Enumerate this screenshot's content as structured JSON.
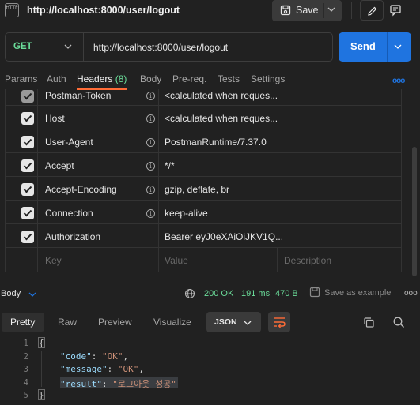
{
  "topbar": {
    "icon_text": "HTTP",
    "title": "http://localhost:8000/user/logout",
    "save_label": "Save"
  },
  "request": {
    "method": "GET",
    "url": "http://localhost:8000/user/logout",
    "send_label": "Send"
  },
  "tabs": {
    "params": "Params",
    "auth": "Auth",
    "headers": "Headers",
    "headers_count": "(8)",
    "body": "Body",
    "prereq": "Pre-req.",
    "tests": "Tests",
    "settings": "Settings",
    "more": "ooo"
  },
  "headers": [
    {
      "key": "Postman-Token",
      "value": "<calculated when reques...",
      "info": "i"
    },
    {
      "key": "Host",
      "value": "<calculated when reques...",
      "info": "i"
    },
    {
      "key": "User-Agent",
      "value": "PostmanRuntime/7.37.0",
      "info": "i"
    },
    {
      "key": "Accept",
      "value": "*/*",
      "info": "i"
    },
    {
      "key": "Accept-Encoding",
      "value": "gzip, deflate, br",
      "info": "i"
    },
    {
      "key": "Connection",
      "value": "keep-alive",
      "info": "i"
    },
    {
      "key": "Authorization",
      "value": "Bearer eyJ0eXAiOiJKV1Q..."
    }
  ],
  "new_row": {
    "key_placeholder": "Key",
    "value_placeholder": "Value",
    "description_placeholder": "Description"
  },
  "response": {
    "label": "Body",
    "status": "200 OK",
    "time": "191 ms",
    "size": "470 B",
    "save_example": "Save as example",
    "more": "ooo"
  },
  "response_tabs": {
    "pretty": "Pretty",
    "raw": "Raw",
    "preview": "Preview",
    "visualize": "Visualize",
    "format": "JSON"
  },
  "code": {
    "line_numbers": [
      "1",
      "2",
      "3",
      "4",
      "5"
    ],
    "open_brace": "{",
    "close_brace": "}",
    "lines": [
      {
        "key": "\"code\"",
        "colon": ": ",
        "value": "\"OK\"",
        "comma": ","
      },
      {
        "key": "\"message\"",
        "colon": ": ",
        "value": "\"OK\"",
        "comma": ","
      },
      {
        "key": "\"result\"",
        "colon": ": ",
        "value": "\"로그아웃 성공\"",
        "comma": ""
      }
    ]
  },
  "colors": {
    "accent_blue": "#1f74e0",
    "method_green": "#6bdd9a",
    "active_tab_orange": "#ff6c37"
  }
}
